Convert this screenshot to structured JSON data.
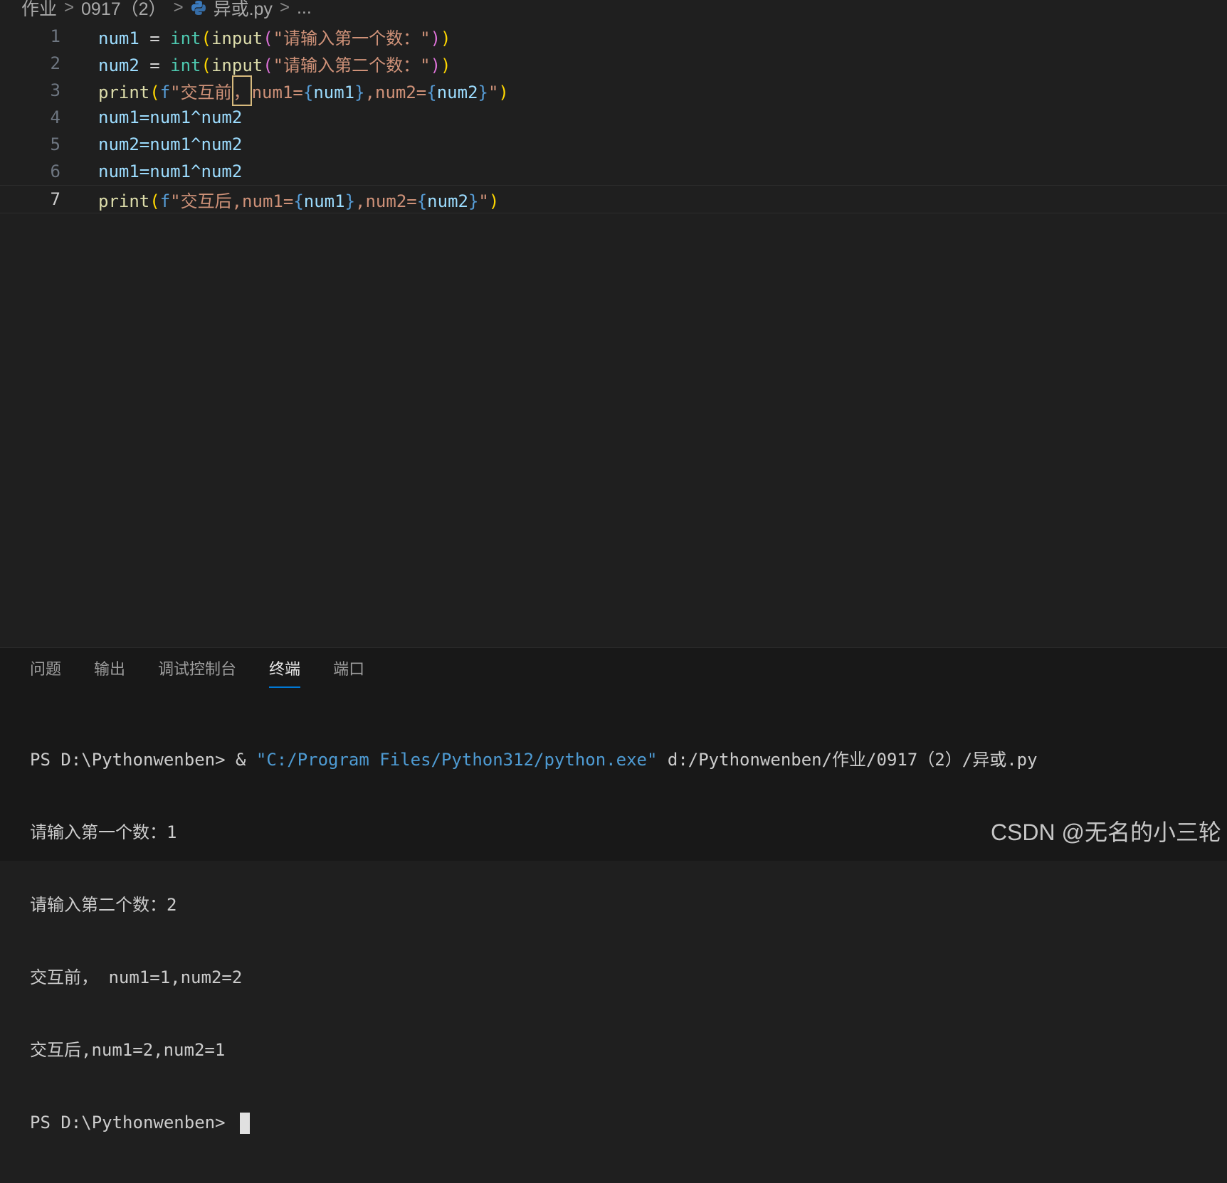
{
  "breadcrumb": {
    "segments": [
      "作业",
      "0917（2）",
      "异或.py",
      "..."
    ],
    "separator": ">"
  },
  "editor": {
    "line_numbers": [
      "1",
      "2",
      "3",
      "4",
      "5",
      "6",
      "7"
    ],
    "current_line": "7",
    "lines": [
      {
        "a": "num1",
        "b": " = ",
        "c": "int",
        "d": "(",
        "e": "input",
        "f": "(",
        "g": "\"请输入第一个数：\"",
        "h": ")",
        "i": ")"
      },
      {
        "a": "num2",
        "b": " = ",
        "c": "int",
        "d": "(",
        "e": "input",
        "f": "(",
        "g": "\"请输入第二个数：\"",
        "h": ")",
        "i": ")"
      },
      {
        "fn": "print",
        "open": "(",
        "pfx": "f",
        "q": "\"",
        "t1": "交互前",
        "t2": "，",
        "t3": "num1=",
        "lb1": "{",
        "v1": "num1",
        "rb1": "}",
        "t4": ",num2=",
        "lb2": "{",
        "v2": "num2",
        "rb2": "}",
        "q2": "\"",
        "close": ")"
      },
      {
        "text": "num1=num1^num2"
      },
      {
        "text": "num2=num1^num2"
      },
      {
        "text": "num1=num1^num2"
      },
      {
        "fn": "print",
        "open": "(",
        "pfx": "f",
        "q": "\"",
        "t1": "交互后,num1=",
        "lb1": "{",
        "v1": "num1",
        "rb1": "}",
        "t4": ",num2=",
        "lb2": "{",
        "v2": "num2",
        "rb2": "}",
        "q2": "\"",
        "close": ")"
      }
    ]
  },
  "panel": {
    "tabs": [
      "问题",
      "输出",
      "调试控制台",
      "终端",
      "端口"
    ],
    "active_tab": "终端",
    "terminal": {
      "prompt1": "PS D:\\Pythonwenben> & ",
      "exe_path": "\"C:/Program Files/Python312/python.exe\"",
      "script_path": " d:/Pythonwenben/作业/0917（2）/异或.py",
      "out1": "请输入第一个数：1",
      "out2": "请输入第二个数：2",
      "out3": "交互前， num1=1,num2=2",
      "out4": "交互后,num1=2,num2=1",
      "prompt2": "PS D:\\Pythonwenben> "
    }
  },
  "watermark": "CSDN @无名的小三轮",
  "colors": {
    "accent": "#0078d4",
    "background": "#1f1f1f",
    "panel": "#181818"
  }
}
